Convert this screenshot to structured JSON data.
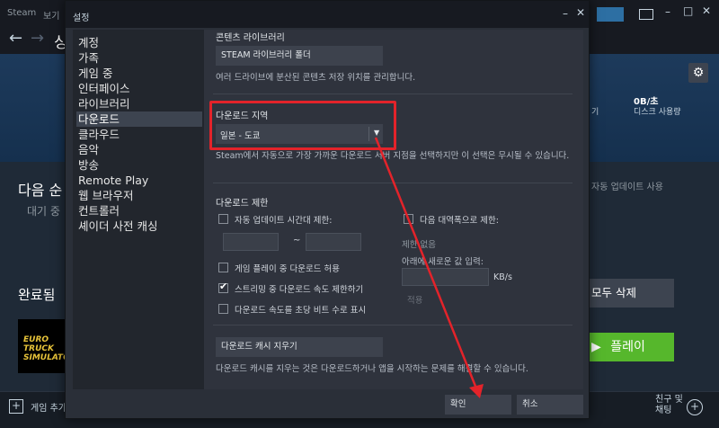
{
  "app": {
    "title": "Steam",
    "menu_view": "보기",
    "nav_partial": "싱",
    "disk_usage_value": "0B/초",
    "disk_usage_label": "디스크 사용량",
    "partial_key": "기",
    "queue_title": "다음 순",
    "queue_sub": "대기 중",
    "auto_update": "자동 업데이트 사용",
    "completed_title": "완료됨",
    "delete_all": "모두 삭제",
    "play_button": "플레이",
    "add_game": "게임 추가",
    "friends_chat": "친구 및\n채팅",
    "game_logo": "EURO TRUCK SIMULATOR"
  },
  "dialog": {
    "title": "설정",
    "sidebar": [
      "계정",
      "가족",
      "게임 중",
      "인터페이스",
      "라이브러리",
      "다운로드",
      "클라우드",
      "음악",
      "방송",
      "Remote Play",
      "웹 브라우저",
      "컨트롤러",
      "셰이더 사전 캐싱"
    ],
    "active_index": 5,
    "content_library": {
      "title": "콘텐츠 라이브러리",
      "button": "STEAM 라이브러리 폴더",
      "desc": "여러 드라이브에 분산된 콘텐츠 저장 위치를 관리합니다."
    },
    "download_region": {
      "title": "다운로드 지역",
      "value": "일본 - 도쿄",
      "desc": "Steam에서 자동으로 가장 가까운 다운로드 서버 지점을 선택하지만 이 선택은 무시될 수 있습니다."
    },
    "download_limit": {
      "title": "다운로드 제한",
      "auto_update_time": "자동 업데이트 시간대 제한:",
      "bandwidth_limit": "다음 대역폭으로 제한:",
      "tilde": "~",
      "no_limit": "제한 없음",
      "enter_new_value": "아래에 새로운 값 입력:",
      "kbs": "KB/s",
      "apply": "적용",
      "allow_during_play": "게임 플레이 중 다운로드 허용",
      "throttle_streaming": "스트리밍 중 다운로드 속도 제한하기",
      "show_bits": "다운로드 속도를 초당 비트 수로 표시"
    },
    "cache": {
      "button": "다운로드 캐시 지우기",
      "desc": "다운로드 캐시를 지우는 것은 다운로드하거나 앱을 시작하는 문제를 해결할 수 있습니다."
    },
    "ok": "확인",
    "cancel": "취소"
  },
  "colors": {
    "highlight": "#e3232a",
    "play_green": "#56b72c"
  }
}
